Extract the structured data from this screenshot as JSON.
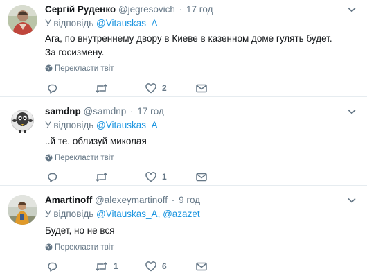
{
  "colors": {
    "link": "#1b95e0",
    "secondary": "#657786",
    "text": "#14171a",
    "divider": "#e6ecf0"
  },
  "tweets": [
    {
      "name": "Сергій Руденко",
      "handle": "@jegresovich",
      "time": "17 год",
      "reply_prefix": "У відповідь",
      "mentions": [
        "@Vitauskas_A"
      ],
      "text": "Ага, по внутреннему двору в Киеве в казенном доме гулять будет. За госизмену.",
      "translate": "Перекласти твіт",
      "replies": "",
      "retweets": "",
      "likes": "2",
      "avatar_icon": "user-photo-avatar"
    },
    {
      "name": "samdnp",
      "handle": "@samdnp",
      "time": "17 год",
      "reply_prefix": "У відповідь",
      "mentions": [
        "@Vitauskas_A"
      ],
      "text": "..й те. облизуй миколая",
      "translate": "Перекласти твіт",
      "replies": "",
      "retweets": "",
      "likes": "1",
      "avatar_icon": "sheep-cartoon-avatar"
    },
    {
      "name": "Amartinoff",
      "handle": "@alexeymartinoff",
      "time": "9 год",
      "reply_prefix": "У відповідь",
      "mentions": [
        "@Vitauskas_A",
        "@azazet"
      ],
      "mention_separator": ",",
      "text": "Будет, но не вся",
      "translate": "Перекласти твіт",
      "replies": "",
      "retweets": "1",
      "likes": "6",
      "avatar_icon": "user-photo-avatar"
    }
  ]
}
